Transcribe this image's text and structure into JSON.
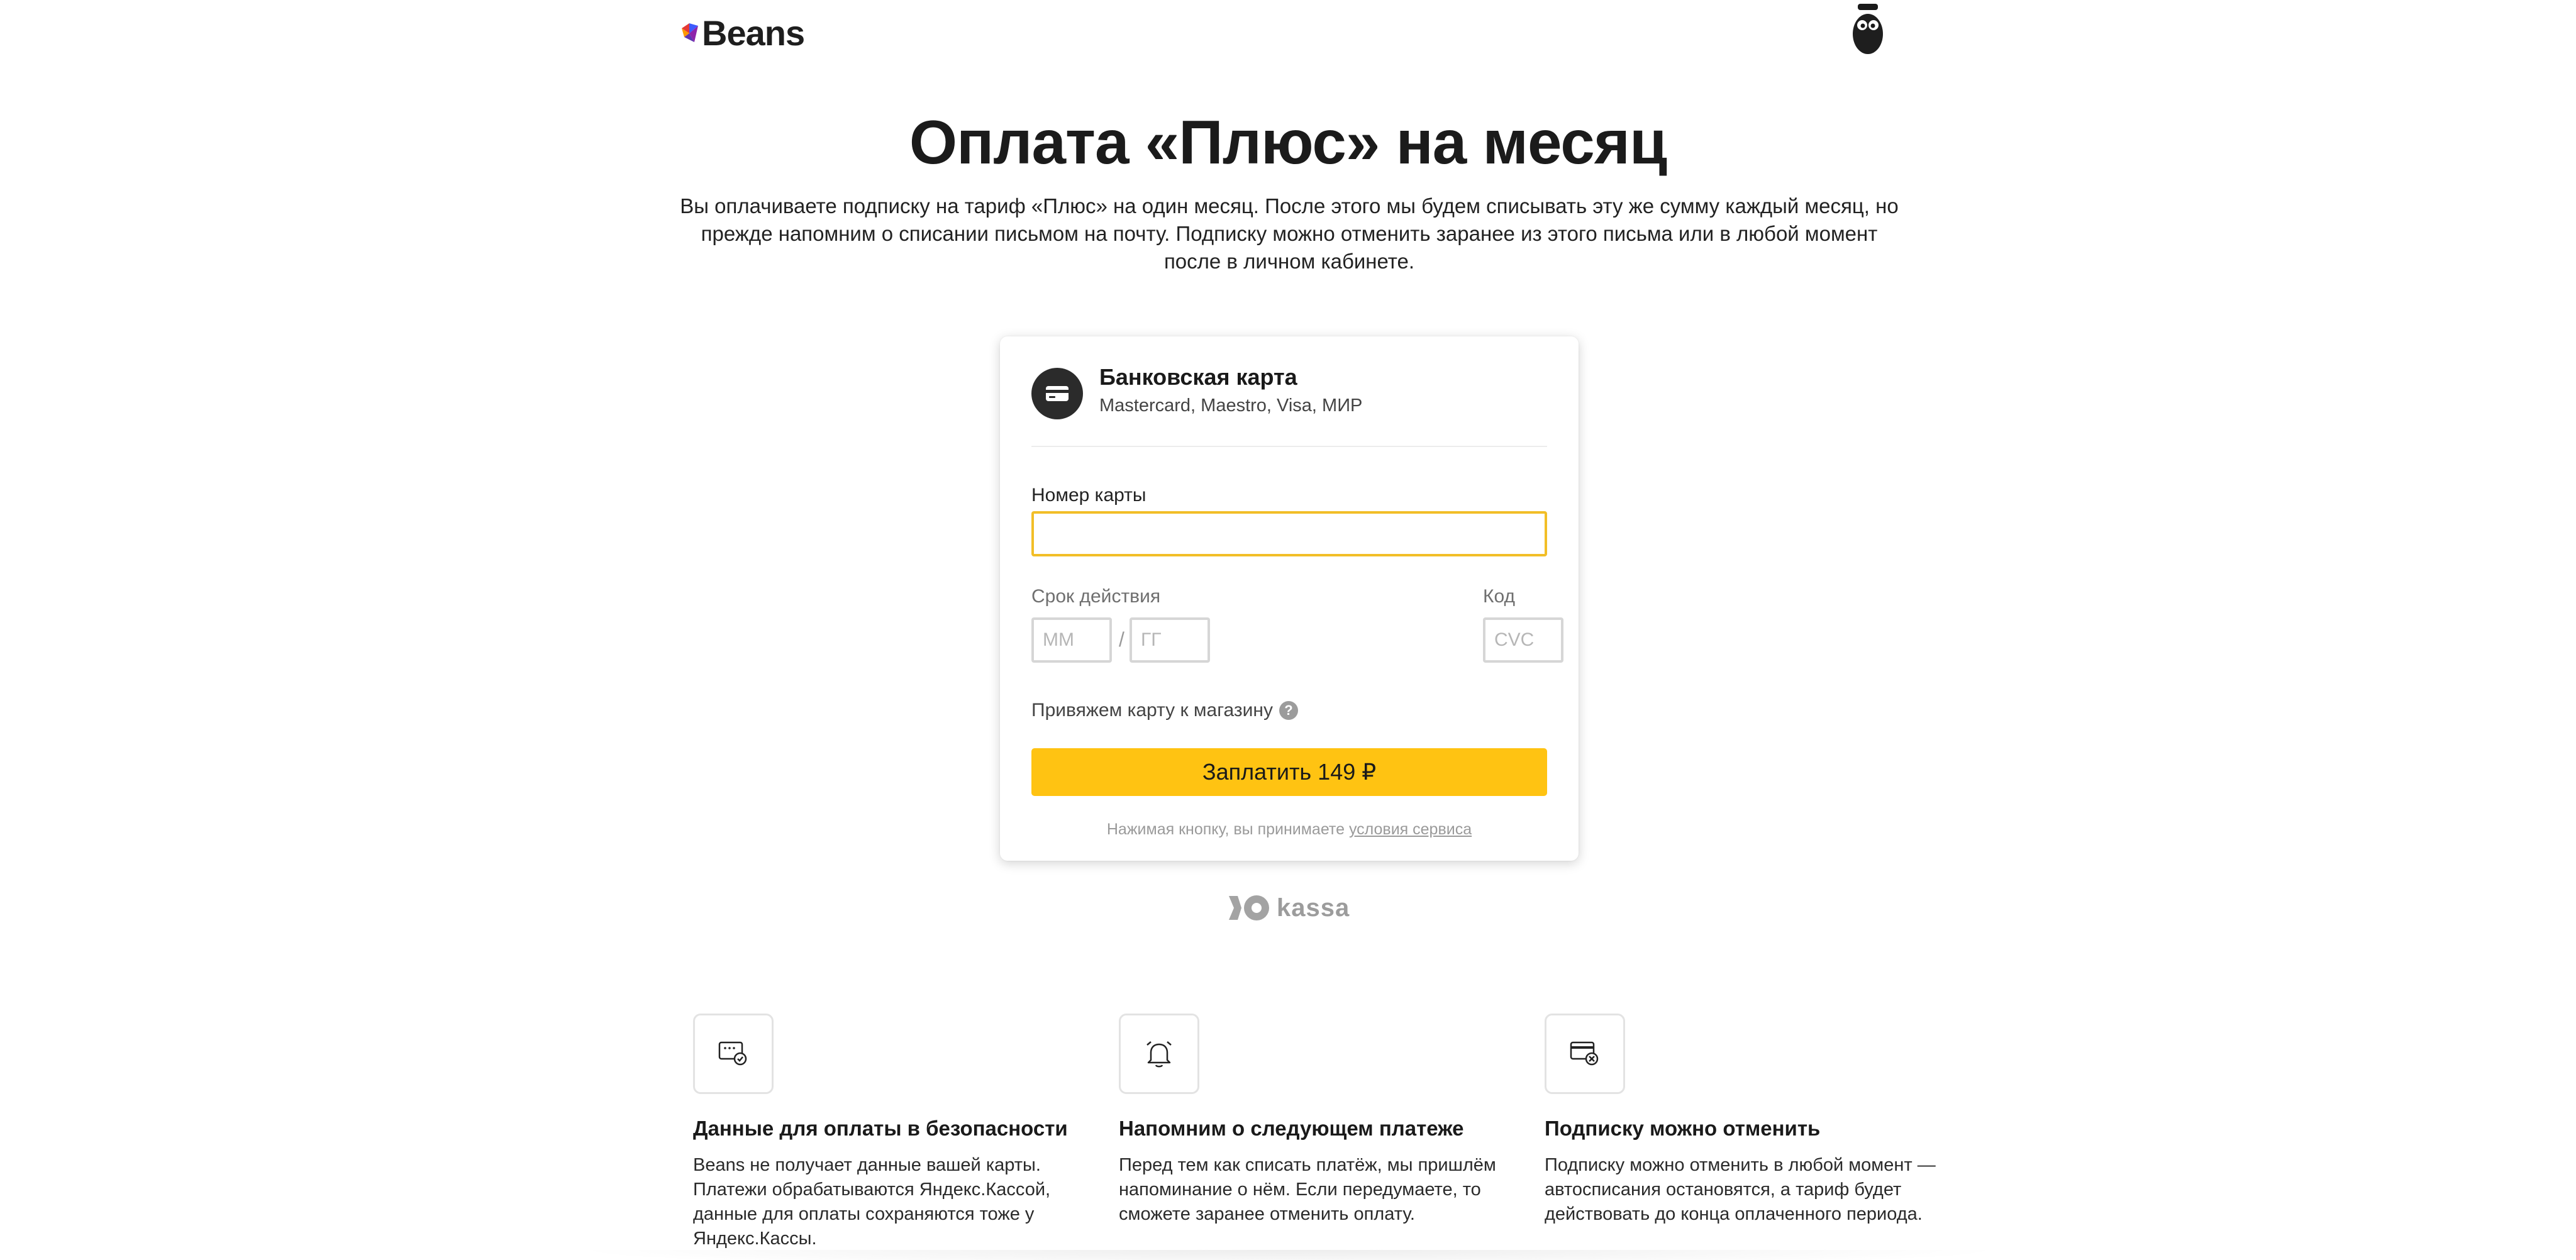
{
  "header": {
    "logo_text": "Beans",
    "logo_colors": [
      "#3d5afe",
      "#e53935",
      "#ff9800",
      "#8e24aa"
    ],
    "avatar_icon": "mascot-avatar-icon"
  },
  "page": {
    "title": "Оплата «Плюс» на месяц",
    "description": "Вы оплачиваете подписку на тариф «Плюс» на один месяц. После этого мы будем списывать эту же сумму каждый месяц, но прежде напомним о списании письмом на почту. Подписку можно отменить заранее из этого письма или в любой момент после в личном кабинете."
  },
  "payment_form": {
    "method_title": "Банковская карта",
    "method_subtitle": "Mastercard, Maestro, Visa, МИР",
    "method_icon": "credit-card-icon",
    "card_number_label": "Номер карты",
    "card_number_value": "",
    "expiry_label": "Срок действия",
    "month_placeholder": "ММ",
    "year_placeholder": "ГГ",
    "expiry_separator": "/",
    "cvc_label": "Код",
    "cvc_placeholder": "CVC",
    "bind_card_text": "Привяжем карту к магазину",
    "bind_card_help": "?",
    "pay_button": "Заплатить 149 ₽",
    "terms_prefix": "Нажимая кнопку, вы принимаете",
    "terms_link": "условия сервиса",
    "accent_color": "#ffc312",
    "active_border_color": "#f2be27"
  },
  "provider": {
    "name": "kassa",
    "icon": "yoomoney-logo-icon"
  },
  "features": [
    {
      "icon": "secure-card-icon",
      "title": "Данные для оплаты в безопасности",
      "text": "Beans не получает данные вашей карты. Платежи обрабатываются Яндекс.Кассой, данные для оплаты сохраняются тоже у Яндекс.Кассы."
    },
    {
      "icon": "bell-icon",
      "title": "Напомним о следующем платеже",
      "text": "Перед тем как списать платёж, мы пришлём напоминание о нём. Если передумаете, то сможете заранее отменить оплату."
    },
    {
      "icon": "cancel-card-icon",
      "title": "Подписку можно отменить",
      "text": "Подписку можно отменить в любой момент — автосписания остановятся, а тариф будет действовать до конца оплаченного периода."
    }
  ]
}
